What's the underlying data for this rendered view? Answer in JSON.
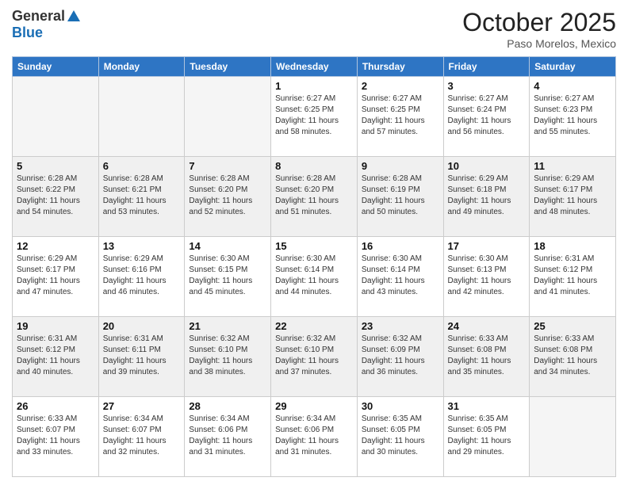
{
  "header": {
    "logo_general": "General",
    "logo_blue": "Blue",
    "month": "October 2025",
    "location": "Paso Morelos, Mexico"
  },
  "weekdays": [
    "Sunday",
    "Monday",
    "Tuesday",
    "Wednesday",
    "Thursday",
    "Friday",
    "Saturday"
  ],
  "weeks": [
    [
      {
        "day": "",
        "sunrise": "",
        "sunset": "",
        "daylight": "",
        "empty": true
      },
      {
        "day": "",
        "sunrise": "",
        "sunset": "",
        "daylight": "",
        "empty": true
      },
      {
        "day": "",
        "sunrise": "",
        "sunset": "",
        "daylight": "",
        "empty": true
      },
      {
        "day": "1",
        "sunrise": "Sunrise: 6:27 AM",
        "sunset": "Sunset: 6:25 PM",
        "daylight": "Daylight: 11 hours and 58 minutes.",
        "empty": false
      },
      {
        "day": "2",
        "sunrise": "Sunrise: 6:27 AM",
        "sunset": "Sunset: 6:25 PM",
        "daylight": "Daylight: 11 hours and 57 minutes.",
        "empty": false
      },
      {
        "day": "3",
        "sunrise": "Sunrise: 6:27 AM",
        "sunset": "Sunset: 6:24 PM",
        "daylight": "Daylight: 11 hours and 56 minutes.",
        "empty": false
      },
      {
        "day": "4",
        "sunrise": "Sunrise: 6:27 AM",
        "sunset": "Sunset: 6:23 PM",
        "daylight": "Daylight: 11 hours and 55 minutes.",
        "empty": false
      }
    ],
    [
      {
        "day": "5",
        "sunrise": "Sunrise: 6:28 AM",
        "sunset": "Sunset: 6:22 PM",
        "daylight": "Daylight: 11 hours and 54 minutes.",
        "empty": false
      },
      {
        "day": "6",
        "sunrise": "Sunrise: 6:28 AM",
        "sunset": "Sunset: 6:21 PM",
        "daylight": "Daylight: 11 hours and 53 minutes.",
        "empty": false
      },
      {
        "day": "7",
        "sunrise": "Sunrise: 6:28 AM",
        "sunset": "Sunset: 6:20 PM",
        "daylight": "Daylight: 11 hours and 52 minutes.",
        "empty": false
      },
      {
        "day": "8",
        "sunrise": "Sunrise: 6:28 AM",
        "sunset": "Sunset: 6:20 PM",
        "daylight": "Daylight: 11 hours and 51 minutes.",
        "empty": false
      },
      {
        "day": "9",
        "sunrise": "Sunrise: 6:28 AM",
        "sunset": "Sunset: 6:19 PM",
        "daylight": "Daylight: 11 hours and 50 minutes.",
        "empty": false
      },
      {
        "day": "10",
        "sunrise": "Sunrise: 6:29 AM",
        "sunset": "Sunset: 6:18 PM",
        "daylight": "Daylight: 11 hours and 49 minutes.",
        "empty": false
      },
      {
        "day": "11",
        "sunrise": "Sunrise: 6:29 AM",
        "sunset": "Sunset: 6:17 PM",
        "daylight": "Daylight: 11 hours and 48 minutes.",
        "empty": false
      }
    ],
    [
      {
        "day": "12",
        "sunrise": "Sunrise: 6:29 AM",
        "sunset": "Sunset: 6:17 PM",
        "daylight": "Daylight: 11 hours and 47 minutes.",
        "empty": false
      },
      {
        "day": "13",
        "sunrise": "Sunrise: 6:29 AM",
        "sunset": "Sunset: 6:16 PM",
        "daylight": "Daylight: 11 hours and 46 minutes.",
        "empty": false
      },
      {
        "day": "14",
        "sunrise": "Sunrise: 6:30 AM",
        "sunset": "Sunset: 6:15 PM",
        "daylight": "Daylight: 11 hours and 45 minutes.",
        "empty": false
      },
      {
        "day": "15",
        "sunrise": "Sunrise: 6:30 AM",
        "sunset": "Sunset: 6:14 PM",
        "daylight": "Daylight: 11 hours and 44 minutes.",
        "empty": false
      },
      {
        "day": "16",
        "sunrise": "Sunrise: 6:30 AM",
        "sunset": "Sunset: 6:14 PM",
        "daylight": "Daylight: 11 hours and 43 minutes.",
        "empty": false
      },
      {
        "day": "17",
        "sunrise": "Sunrise: 6:30 AM",
        "sunset": "Sunset: 6:13 PM",
        "daylight": "Daylight: 11 hours and 42 minutes.",
        "empty": false
      },
      {
        "day": "18",
        "sunrise": "Sunrise: 6:31 AM",
        "sunset": "Sunset: 6:12 PM",
        "daylight": "Daylight: 11 hours and 41 minutes.",
        "empty": false
      }
    ],
    [
      {
        "day": "19",
        "sunrise": "Sunrise: 6:31 AM",
        "sunset": "Sunset: 6:12 PM",
        "daylight": "Daylight: 11 hours and 40 minutes.",
        "empty": false
      },
      {
        "day": "20",
        "sunrise": "Sunrise: 6:31 AM",
        "sunset": "Sunset: 6:11 PM",
        "daylight": "Daylight: 11 hours and 39 minutes.",
        "empty": false
      },
      {
        "day": "21",
        "sunrise": "Sunrise: 6:32 AM",
        "sunset": "Sunset: 6:10 PM",
        "daylight": "Daylight: 11 hours and 38 minutes.",
        "empty": false
      },
      {
        "day": "22",
        "sunrise": "Sunrise: 6:32 AM",
        "sunset": "Sunset: 6:10 PM",
        "daylight": "Daylight: 11 hours and 37 minutes.",
        "empty": false
      },
      {
        "day": "23",
        "sunrise": "Sunrise: 6:32 AM",
        "sunset": "Sunset: 6:09 PM",
        "daylight": "Daylight: 11 hours and 36 minutes.",
        "empty": false
      },
      {
        "day": "24",
        "sunrise": "Sunrise: 6:33 AM",
        "sunset": "Sunset: 6:08 PM",
        "daylight": "Daylight: 11 hours and 35 minutes.",
        "empty": false
      },
      {
        "day": "25",
        "sunrise": "Sunrise: 6:33 AM",
        "sunset": "Sunset: 6:08 PM",
        "daylight": "Daylight: 11 hours and 34 minutes.",
        "empty": false
      }
    ],
    [
      {
        "day": "26",
        "sunrise": "Sunrise: 6:33 AM",
        "sunset": "Sunset: 6:07 PM",
        "daylight": "Daylight: 11 hours and 33 minutes.",
        "empty": false
      },
      {
        "day": "27",
        "sunrise": "Sunrise: 6:34 AM",
        "sunset": "Sunset: 6:07 PM",
        "daylight": "Daylight: 11 hours and 32 minutes.",
        "empty": false
      },
      {
        "day": "28",
        "sunrise": "Sunrise: 6:34 AM",
        "sunset": "Sunset: 6:06 PM",
        "daylight": "Daylight: 11 hours and 31 minutes.",
        "empty": false
      },
      {
        "day": "29",
        "sunrise": "Sunrise: 6:34 AM",
        "sunset": "Sunset: 6:06 PM",
        "daylight": "Daylight: 11 hours and 31 minutes.",
        "empty": false
      },
      {
        "day": "30",
        "sunrise": "Sunrise: 6:35 AM",
        "sunset": "Sunset: 6:05 PM",
        "daylight": "Daylight: 11 hours and 30 minutes.",
        "empty": false
      },
      {
        "day": "31",
        "sunrise": "Sunrise: 6:35 AM",
        "sunset": "Sunset: 6:05 PM",
        "daylight": "Daylight: 11 hours and 29 minutes.",
        "empty": false
      },
      {
        "day": "",
        "sunrise": "",
        "sunset": "",
        "daylight": "",
        "empty": true
      }
    ]
  ]
}
